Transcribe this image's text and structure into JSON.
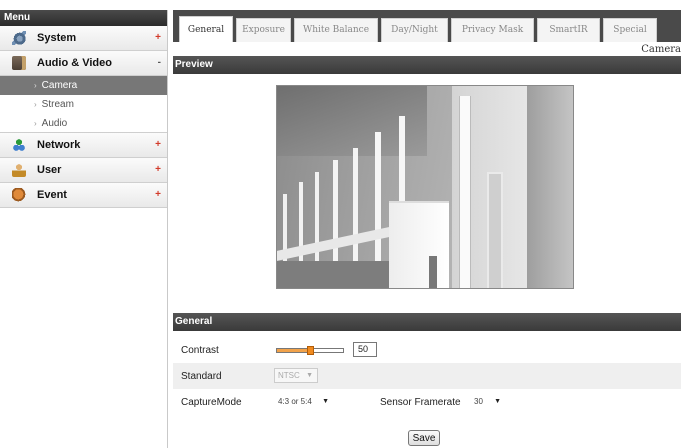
{
  "sidebar": {
    "header": "Menu",
    "items": [
      {
        "label": "System",
        "toggle": "+",
        "icon": "system-icon"
      },
      {
        "label": "Audio & Video",
        "toggle": "-",
        "icon": "audio-video-icon",
        "children": [
          {
            "label": "Camera",
            "active": true
          },
          {
            "label": "Stream",
            "active": false
          },
          {
            "label": "Audio",
            "active": false
          }
        ]
      },
      {
        "label": "Network",
        "toggle": "+",
        "icon": "network-icon"
      },
      {
        "label": "User",
        "toggle": "+",
        "icon": "user-icon"
      },
      {
        "label": "Event",
        "toggle": "+",
        "icon": "event-icon"
      }
    ]
  },
  "tabs": [
    {
      "label": "General",
      "active": true
    },
    {
      "label": "Exposure",
      "active": false
    },
    {
      "label": "White Balance",
      "active": false
    },
    {
      "label": "Day/Night",
      "active": false
    },
    {
      "label": "Privacy Mask",
      "active": false
    },
    {
      "label": "SmartIR",
      "active": false
    },
    {
      "label": "Special",
      "active": false
    }
  ],
  "page_label": "Camera",
  "preview": {
    "title": "Preview"
  },
  "general": {
    "title": "General",
    "contrast": {
      "label": "Contrast",
      "value": "50",
      "level_percent": 50
    },
    "standard": {
      "label": "Standard",
      "selected": "NTSC",
      "disabled": true
    },
    "capture_mode": {
      "label": "CaptureMode",
      "selected": "4:3 or 5:4"
    },
    "sensor_framerate": {
      "label": "Sensor Framerate",
      "selected": "30"
    }
  },
  "save_label": "Save",
  "colors": {
    "header_bar": "#3a3a3a",
    "slider_thumb": "#f08a1e",
    "toggle": "#d23a2a",
    "active_subitem": "#777777"
  }
}
